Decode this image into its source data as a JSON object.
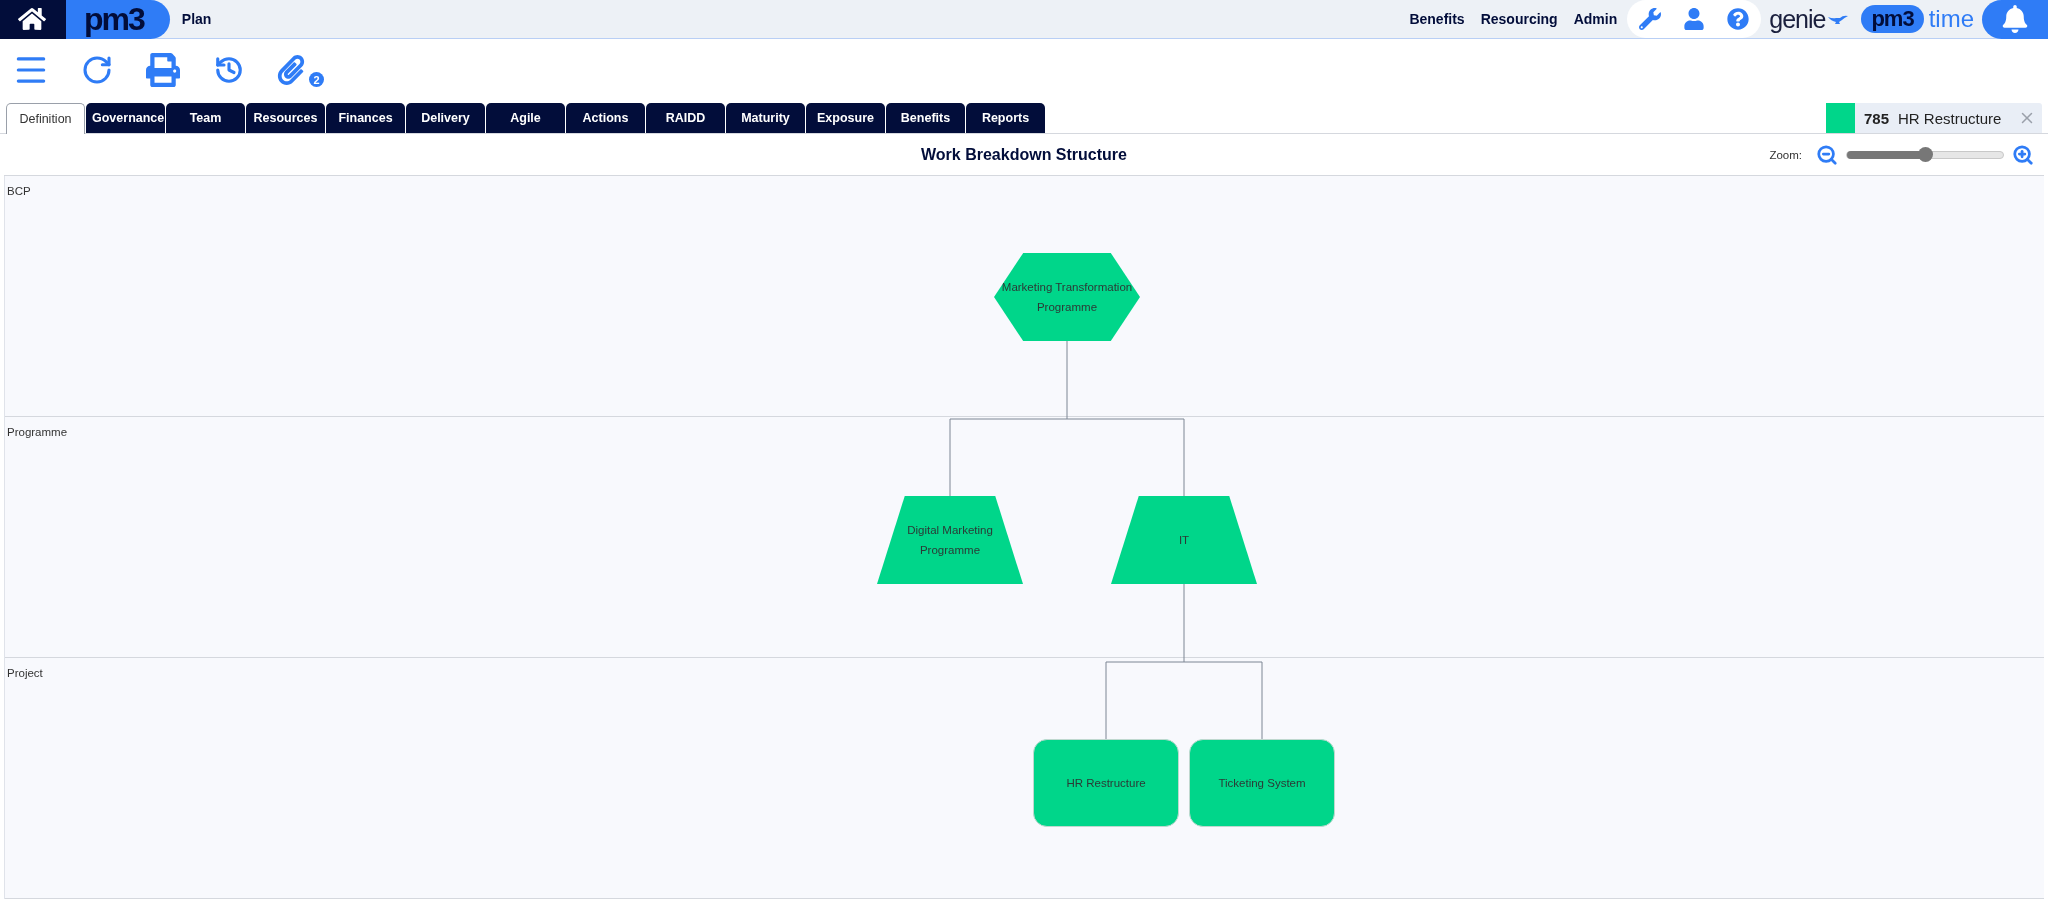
{
  "header": {
    "logo": "pm3",
    "page_title": "Plan",
    "links": [
      "Benefits",
      "Resourcing",
      "Admin"
    ],
    "genie_logo": "genie",
    "time_logo": {
      "mark": "pm3",
      "word": "time"
    }
  },
  "toolbar": {
    "attachments_badge": "2"
  },
  "tabs": [
    {
      "label": "Definition",
      "selected": true
    },
    {
      "label": "Governance",
      "selected": false
    },
    {
      "label": "Team",
      "selected": false
    },
    {
      "label": "Resources",
      "selected": false
    },
    {
      "label": "Finances",
      "selected": false
    },
    {
      "label": "Delivery",
      "selected": false
    },
    {
      "label": "Agile",
      "selected": false
    },
    {
      "label": "Actions",
      "selected": false
    },
    {
      "label": "RAIDD",
      "selected": false
    },
    {
      "label": "Maturity",
      "selected": false
    },
    {
      "label": "Exposure",
      "selected": false
    },
    {
      "label": "Benefits",
      "selected": false
    },
    {
      "label": "Reports",
      "selected": false
    }
  ],
  "project_chip": {
    "number": "785",
    "name": "HR Restructure",
    "color": "#00d68a"
  },
  "panel": {
    "title": "Work Breakdown Structure",
    "zoom_label": "Zoom:",
    "zoom": {
      "level": 0.5
    }
  },
  "lanes": [
    "BCP",
    "Programme",
    "Project"
  ],
  "tree": {
    "label": "Marketing Transformation Programme",
    "kind": "hexagon",
    "children": [
      {
        "label": "Digital Marketing Programme",
        "kind": "trapezoid"
      },
      {
        "label": "IT",
        "kind": "trapezoid",
        "children": [
          {
            "label": "HR Restructure",
            "kind": "rounded"
          },
          {
            "label": "Ticketing System",
            "kind": "rounded"
          }
        ]
      }
    ]
  }
}
